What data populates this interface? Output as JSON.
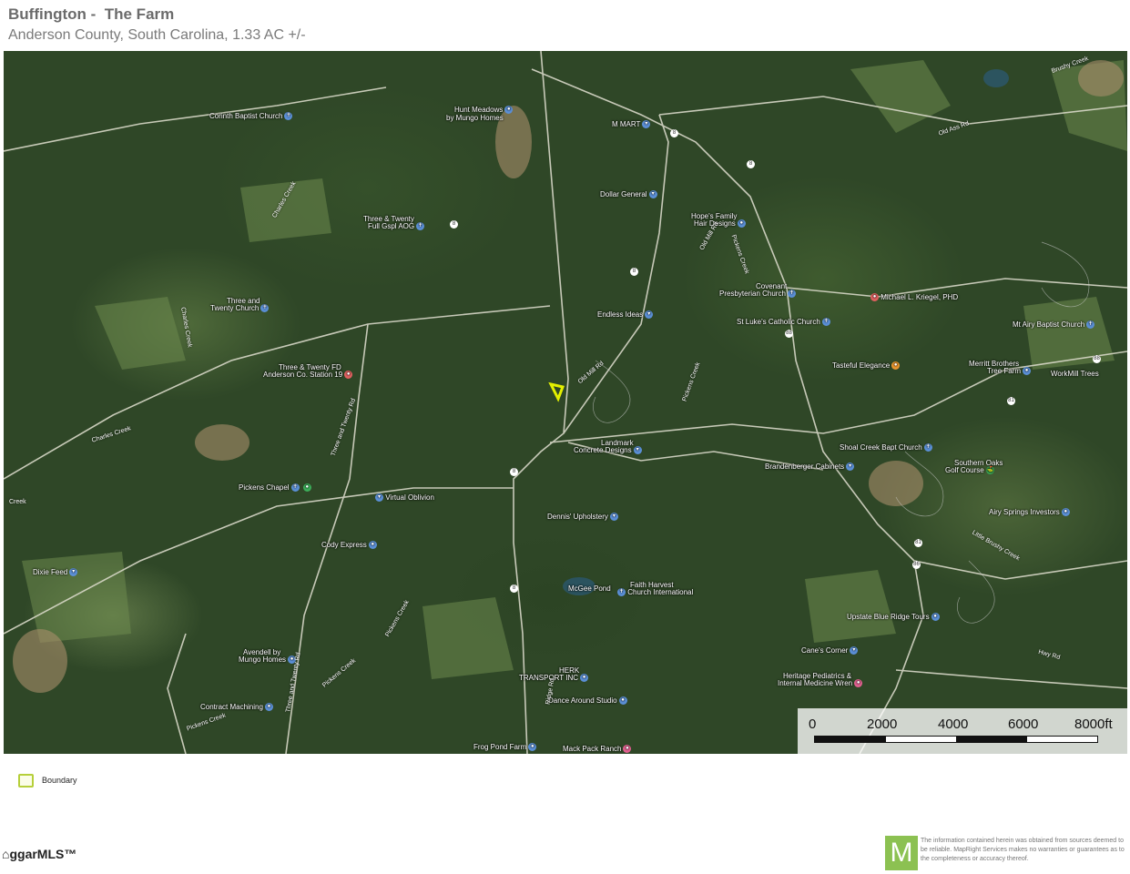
{
  "header": {
    "title": "Buffington -  The Farm",
    "subtitle": "Anderson County, South Carolina, 1.33 AC +/-"
  },
  "map": {
    "places": [
      {
        "label": "Corinth Baptist Church",
        "pin": "blue"
      },
      {
        "label": "Hunt Meadows",
        "pin": "blue"
      },
      {
        "label": "by Mungo Homes",
        "pin": "none"
      },
      {
        "label": "M MART",
        "pin": "blue"
      },
      {
        "label": "Dollar General",
        "pin": "blue"
      },
      {
        "label": "Hope's Family",
        "pin": "none"
      },
      {
        "label": "Hair Designs",
        "pin": "blue"
      },
      {
        "label": "Three & Twenty",
        "pin": "none"
      },
      {
        "label": "Full Gspl AOG",
        "pin": "blue"
      },
      {
        "label": "Three and",
        "pin": "none"
      },
      {
        "label": "Twenty Church",
        "pin": "blue"
      },
      {
        "label": "Covenant",
        "pin": "none"
      },
      {
        "label": "Presbyterian Church",
        "pin": "blue"
      },
      {
        "label": "Michael L. Kriegel, PHD",
        "pin": "red"
      },
      {
        "label": "Endless Ideas",
        "pin": "blue"
      },
      {
        "label": "St Luke's Catholic Church",
        "pin": "blue"
      },
      {
        "label": "Mt Airy Baptist Church",
        "pin": "blue"
      },
      {
        "label": "Three & Twenty FD",
        "pin": "none"
      },
      {
        "label": "Anderson Co. Station 19",
        "pin": "red"
      },
      {
        "label": "Tasteful Elegance",
        "pin": "orange"
      },
      {
        "label": "Merritt Brothers",
        "pin": "none"
      },
      {
        "label": "Tree Farm",
        "pin": "blue"
      },
      {
        "label": "WorkMill Trees",
        "pin": "none"
      },
      {
        "label": "Landmark",
        "pin": "none"
      },
      {
        "label": "Concrete Designs",
        "pin": "blue"
      },
      {
        "label": "Shoal Creek Bapt Church",
        "pin": "blue"
      },
      {
        "label": "Southern Oaks",
        "pin": "none"
      },
      {
        "label": "Golf Course",
        "pin": "green"
      },
      {
        "label": "Brandenberger Cabinets",
        "pin": "blue"
      },
      {
        "label": "Pickens Chapel",
        "pin": "blue"
      },
      {
        "label": "Virtual Oblivion",
        "pin": "blue"
      },
      {
        "label": "Dennis' Upholstery",
        "pin": "blue"
      },
      {
        "label": "Airy Springs Investors",
        "pin": "blue"
      },
      {
        "label": "Cody Express",
        "pin": "blue"
      },
      {
        "label": "Dixie Feed",
        "pin": "blue"
      },
      {
        "label": "McGee Pond",
        "pin": "none"
      },
      {
        "label": "Faith Harvest",
        "pin": "none"
      },
      {
        "label": "Church International",
        "pin": "blue"
      },
      {
        "label": "Upstate Blue Ridge Tours",
        "pin": "blue"
      },
      {
        "label": "Avendell by",
        "pin": "none"
      },
      {
        "label": "Mungo Homes",
        "pin": "blue"
      },
      {
        "label": "Cane's Corner",
        "pin": "blue"
      },
      {
        "label": "HERK",
        "pin": "none"
      },
      {
        "label": "TRANSPORT INC",
        "pin": "blue"
      },
      {
        "label": "Heritage Pediatrics &",
        "pin": "none"
      },
      {
        "label": "Internal Medicine Wren",
        "pin": "pink"
      },
      {
        "label": "Contract Machining",
        "pin": "blue"
      },
      {
        "label": "Dance Around Studio",
        "pin": "blue"
      },
      {
        "label": "Frog Pond Farm",
        "pin": "blue"
      },
      {
        "label": "Mack Pack Ranch",
        "pin": "pink"
      }
    ],
    "road_labels": [
      "Charles Creek",
      "Charles Creek",
      "Charles Creek",
      "Three and Twenty Rd",
      "Three and Twenty Rd",
      "Old Mill Rd",
      "Old Mill Rd",
      "Pickens Creek",
      "Pickens Creek",
      "Pickens Creek",
      "Pickens Creek",
      "Pickens Creek",
      "Little Brushy Creek",
      "Old Ass Rd",
      "Brushy Creek",
      "Hwy Rd",
      "Creek",
      "Ridge Rd"
    ],
    "shields": [
      "8",
      "8",
      "8",
      "8",
      "8",
      "81",
      "81",
      "86",
      "88",
      "88",
      "8"
    ],
    "scale": {
      "ticks": [
        "0",
        "2000",
        "4000",
        "6000",
        "8000ft"
      ],
      "unit": "ft"
    },
    "colors": {
      "boundary": "#e4f000",
      "vegetation_dark": "#2f4727",
      "road": "#d8d8c8"
    }
  },
  "legend": {
    "items": [
      {
        "label": "Boundary",
        "color": "#b6cf3a"
      }
    ]
  },
  "footer": {
    "left_logo": "ggarMLS™",
    "m_logo": "M",
    "disclaimer": "The information contained herein was obtained from sources deemed to be reliable.  MapRight Services makes no warranties or guarantees as to the completeness or accuracy thereof."
  }
}
